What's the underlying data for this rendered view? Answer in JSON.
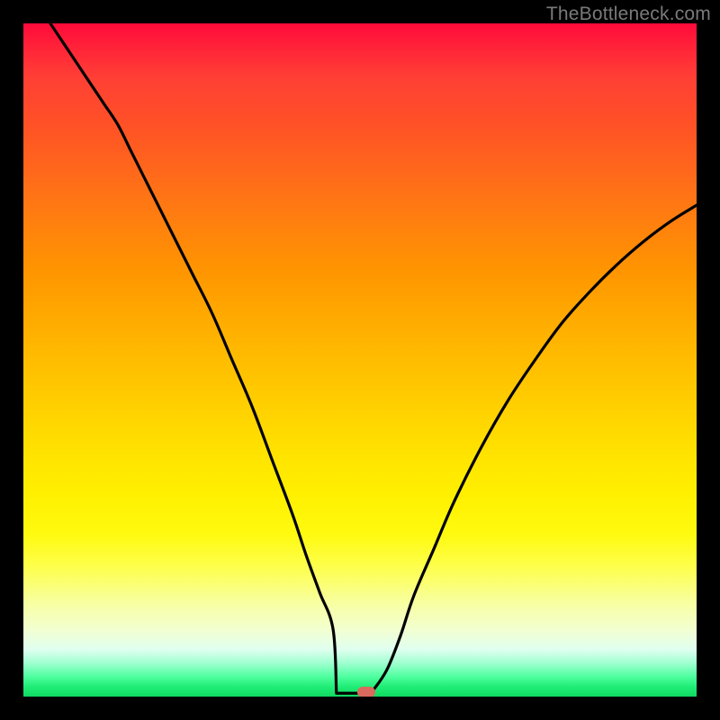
{
  "watermark": {
    "text": "TheBottleneck.com"
  },
  "colors": {
    "marker": "#d96a5e",
    "curve": "#000000"
  },
  "chart_data": {
    "type": "line",
    "title": "",
    "xlabel": "",
    "ylabel": "",
    "xlim": [
      0,
      100
    ],
    "ylim": [
      0,
      100
    ],
    "grid": false,
    "legend": false,
    "series": [
      {
        "name": "bottleneck-curve",
        "x": [
          4,
          6,
          8,
          10,
          12,
          14,
          16,
          18,
          20,
          22,
          25,
          28,
          31,
          34,
          37,
          40,
          42,
          44,
          46,
          48,
          49,
          50,
          51,
          52,
          54,
          56,
          58,
          61,
          64,
          68,
          72,
          76,
          80,
          84,
          88,
          92,
          96,
          100
        ],
        "y": [
          100,
          97,
          94,
          91,
          88,
          85,
          81,
          77,
          73,
          69,
          63,
          57,
          50,
          43,
          35,
          27,
          21,
          15.5,
          10,
          5,
          2.5,
          1,
          0.5,
          1,
          4,
          9,
          15,
          22,
          29,
          37,
          44,
          50,
          55.5,
          60,
          64,
          67.5,
          70.5,
          73
        ]
      }
    ],
    "flat_segment": {
      "x_start": 46.5,
      "x_end": 51.5,
      "y": 0.5
    },
    "marker": {
      "x": 51,
      "y": 0.7
    },
    "background_gradient": {
      "direction": "top-to-bottom",
      "stops": [
        {
          "pos": 0,
          "color": "#ff0a3a"
        },
        {
          "pos": 15,
          "color": "#ff5126"
        },
        {
          "pos": 37,
          "color": "#ff9600"
        },
        {
          "pos": 57,
          "color": "#ffd000"
        },
        {
          "pos": 76,
          "color": "#fffa10"
        },
        {
          "pos": 90,
          "color": "#f2ffd0"
        },
        {
          "pos": 97,
          "color": "#50ffa0"
        },
        {
          "pos": 100,
          "color": "#10d860"
        }
      ]
    }
  }
}
